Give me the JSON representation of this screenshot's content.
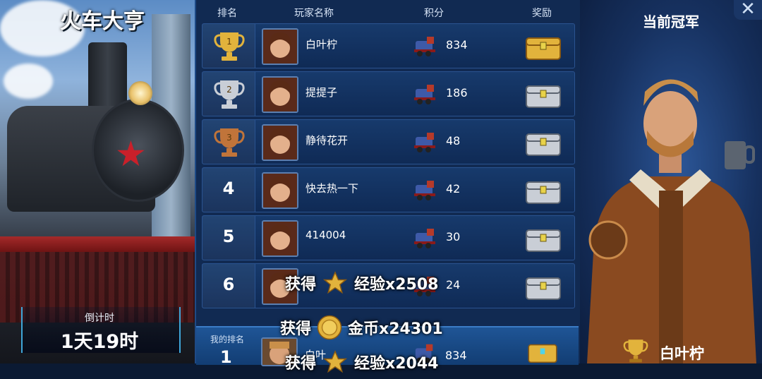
{
  "left_panel": {
    "title": "火车大亨",
    "countdown_label": "倒计时",
    "countdown_value": "1天19时"
  },
  "leaderboard": {
    "headers": {
      "rank": "排名",
      "player": "玩家名称",
      "score": "积分",
      "reward": "奖励"
    },
    "rows": [
      {
        "rank": "1",
        "name": "白叶柠",
        "score": "834",
        "trophy": "gold-trophy-icon",
        "chest": "gold"
      },
      {
        "rank": "2",
        "name": "提提子",
        "score": "186",
        "trophy": "silver-trophy-icon",
        "chest": "silver"
      },
      {
        "rank": "3",
        "name": "静待花开",
        "score": "48",
        "trophy": "bronze-trophy-icon",
        "chest": "silver"
      },
      {
        "rank": "4",
        "name": "快去热一下",
        "score": "42",
        "chest": "silver"
      },
      {
        "rank": "5",
        "name": "414004",
        "score": "30",
        "chest": "silver"
      },
      {
        "rank": "6",
        "name": "子",
        "score": "24",
        "chest": "silver"
      }
    ]
  },
  "my_rank": {
    "label": "我的排名",
    "rank": "1",
    "name": "白叶",
    "score": "834"
  },
  "champion": {
    "title": "当前冠军",
    "name": "白叶柠",
    "close_icon": "✕"
  },
  "floating_rewards": [
    {
      "prefix": "获得",
      "icon": "star",
      "text": "经验x2508"
    },
    {
      "prefix": "获得",
      "icon": "coin",
      "text": "金币x24301"
    },
    {
      "prefix": "获得",
      "icon": "star",
      "text": "经验x2044"
    }
  ],
  "colors": {
    "gold": "#e2b33c",
    "silver": "#c9ced6",
    "bronze": "#c0743a",
    "panel": "#112a52"
  }
}
